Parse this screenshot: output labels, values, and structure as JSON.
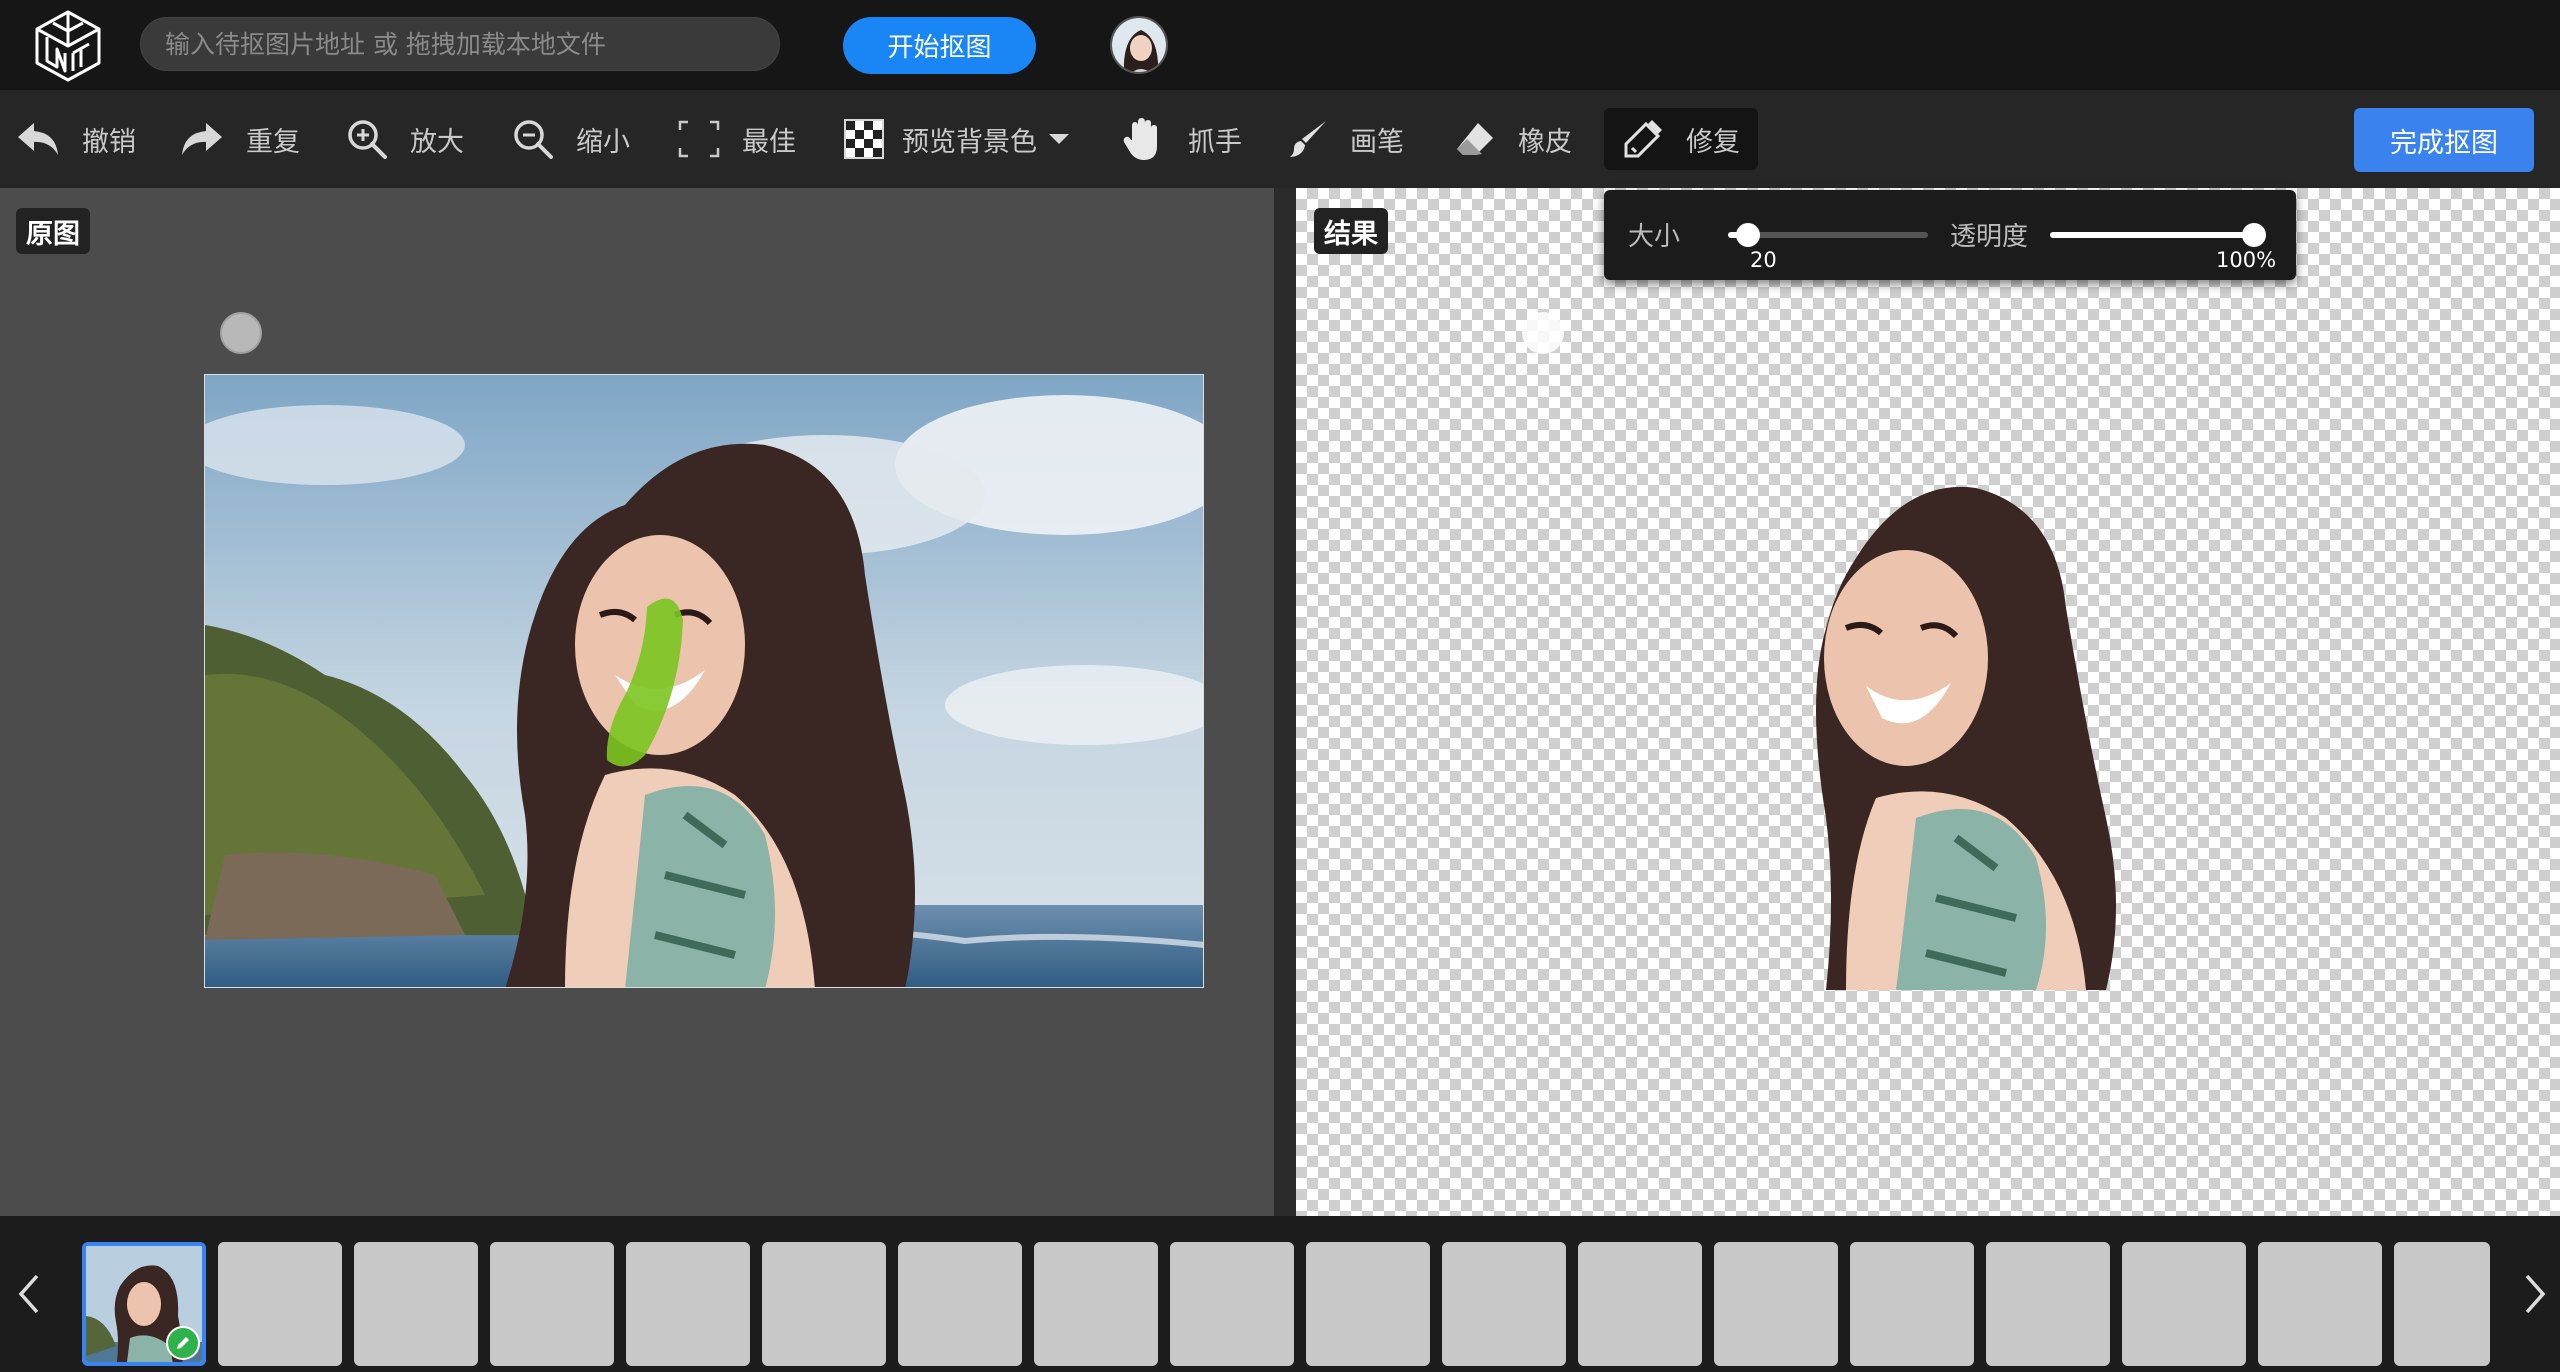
{
  "header": {
    "url_placeholder": "输入待抠图片地址 或 拖拽加载本地文件",
    "start_button": "开始抠图"
  },
  "toolbar": {
    "items": [
      {
        "label": "撤销",
        "icon": "undo-icon"
      },
      {
        "label": "重复",
        "icon": "redo-icon"
      },
      {
        "label": "放大",
        "icon": "zoom-in-icon"
      },
      {
        "label": "缩小",
        "icon": "zoom-out-icon"
      },
      {
        "label": "最佳",
        "icon": "fit-icon"
      },
      {
        "label": "预览背景色",
        "icon": "checkerboard-icon"
      },
      {
        "label": "抓手",
        "icon": "hand-icon"
      },
      {
        "label": "画笔",
        "icon": "brush-icon"
      },
      {
        "label": "橡皮",
        "icon": "eraser-icon"
      },
      {
        "label": "修复",
        "icon": "repair-brush-icon",
        "active": true
      }
    ],
    "done_button": "完成抠图"
  },
  "panels": {
    "left_label": "原图",
    "right_label": "结果"
  },
  "brush_settings": {
    "size_label": "大小",
    "size_value": "20",
    "size_level": 0.1,
    "opacity_label": "透明度",
    "opacity_value": "100%",
    "opacity_level": 1.0
  },
  "filmstrip": {
    "thumbnail_count": 18,
    "selected_index": 0
  },
  "colors": {
    "accent_blue": "#1a86f5",
    "done_blue": "#3a83ee",
    "mask_green": "#7cc520",
    "check_green": "#2fb24a"
  }
}
